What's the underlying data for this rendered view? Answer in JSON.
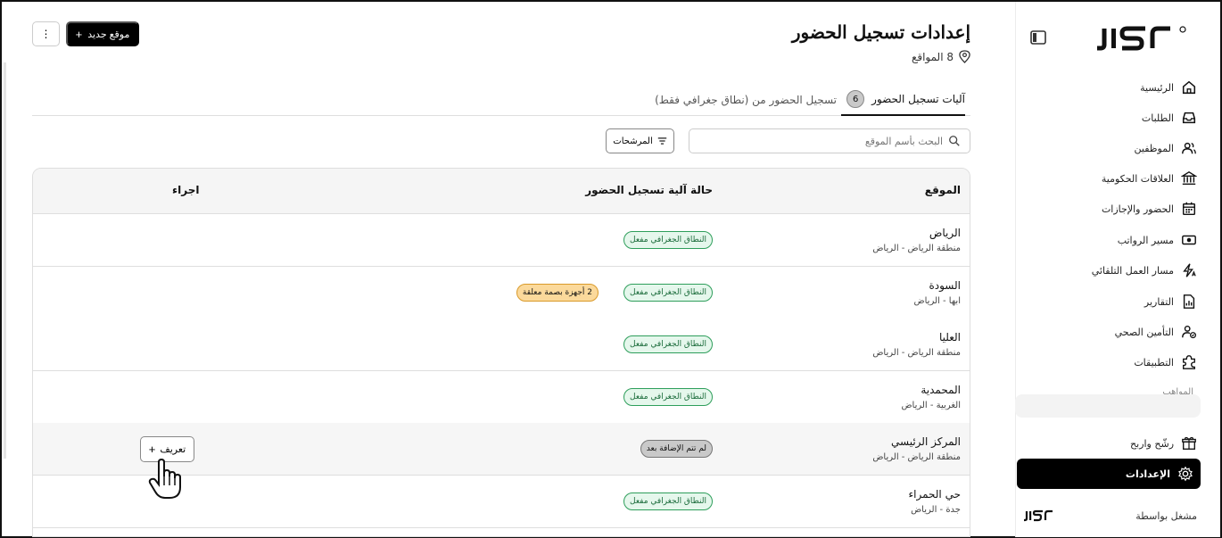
{
  "sidebar": {
    "items": [
      {
        "label": "الرئيسية",
        "icon": "home-icon"
      },
      {
        "label": "الطلبات",
        "icon": "inbox-icon"
      },
      {
        "label": "الموظفين",
        "icon": "users-icon"
      },
      {
        "label": "العلاقات الحكومية",
        "icon": "bank-icon"
      },
      {
        "label": "الحضور والإجازات",
        "icon": "calendar-icon"
      },
      {
        "label": "مسير الرواتب",
        "icon": "money-icon"
      },
      {
        "label": "مسار العمل التلقائي",
        "icon": "automation-icon"
      },
      {
        "label": "التقارير",
        "icon": "report-icon"
      },
      {
        "label": "التأمين الصحي",
        "icon": "health-insurance-icon"
      },
      {
        "label": "التطبيقات",
        "icon": "puzzle-icon"
      }
    ],
    "faded_item": "المواهب",
    "refer_item": "رشّح واربح",
    "active_item": "الإعدادات",
    "operated_by": "مشغل بواسطة"
  },
  "header": {
    "title": "إعدادات تسجيل الحضور",
    "locations_count": "8 المواقع",
    "new_location_button": "موقع جديد",
    "more_button": "⋮"
  },
  "tabs": [
    {
      "label": "آليات تسجيل الحضور",
      "badge": "6",
      "active": true
    },
    {
      "label": "تسجيل الحضور من (نطاق جغرافي فقط)",
      "active": false
    }
  ],
  "toolbar": {
    "search_placeholder": "البحث بأسم الموقع",
    "filters_button": "المرشحات"
  },
  "table": {
    "columns": [
      "الموقع",
      "حالة آلية تسجيل الحضور",
      "اجراء"
    ],
    "rows": [
      {
        "name": "الرياض",
        "region": "منطقة الرياض - الرياض",
        "status": "النطاق الجغرافي مفعل",
        "status_type": "green",
        "extra_badge": "",
        "action": ""
      },
      {
        "name": "السودة",
        "region": "ابها - الرياض",
        "status": "النطاق الجغرافي مفعل",
        "status_type": "green",
        "extra_badge": "2 أجهزة بصمة معلقة",
        "action": ""
      },
      {
        "name": "العليا",
        "region": "منطقة الرياض - الرياض",
        "status": "النطاق الجغرافي مفعل",
        "status_type": "green",
        "extra_badge": "",
        "action": ""
      },
      {
        "name": "المحمدية",
        "region": "الغربية - الرياض",
        "status": "النطاق الجغرافي مفعل",
        "status_type": "green",
        "extra_badge": "",
        "action": ""
      },
      {
        "name": "المركز الرئيسي",
        "region": "منطقة الرياض - الرياض",
        "status": "لم تتم الإضافة بعد",
        "status_type": "gray",
        "extra_badge": "",
        "action": "تعريف"
      },
      {
        "name": "حي الحمراء",
        "region": "جدة - الرياض",
        "status": "النطاق الجغرافي مفعل",
        "status_type": "green",
        "extra_badge": "",
        "action": ""
      }
    ]
  },
  "colors": {
    "accent": "#000000",
    "green_badge_bg": "#e5f7ec",
    "green_badge_border": "#2e9e5b",
    "amber_badge_bg": "#fbd99b",
    "gray_badge_bg": "#c9c9c9"
  }
}
